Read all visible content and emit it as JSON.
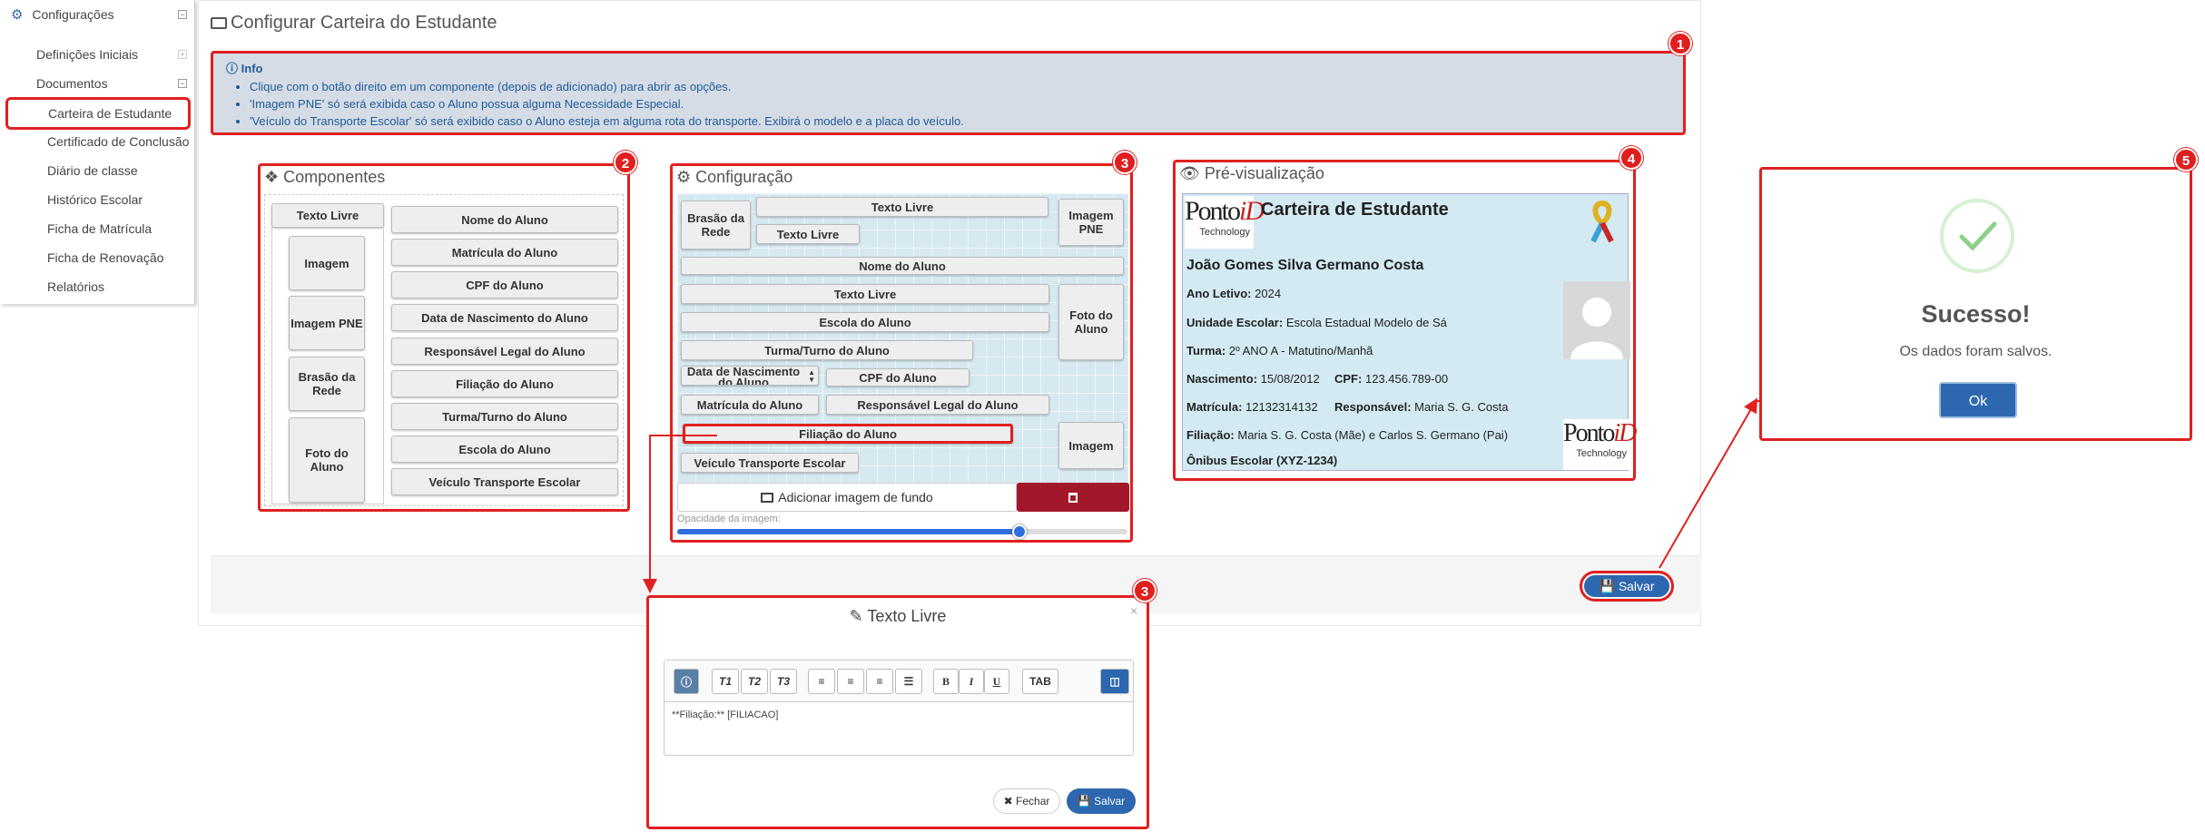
{
  "sidebar": {
    "root": "Configurações",
    "items": [
      {
        "label": "Definições Iniciais"
      },
      {
        "label": "Documentos"
      },
      {
        "label": "Carteira de Estudante"
      },
      {
        "label": "Certificado de Conclusão"
      },
      {
        "label": "Diário de classe"
      },
      {
        "label": "Histórico Escolar"
      },
      {
        "label": "Ficha de Matrícula"
      },
      {
        "label": "Ficha de Renovação"
      },
      {
        "label": "Relatórios"
      }
    ]
  },
  "page": {
    "title": "Configurar Carteira do Estudante"
  },
  "info": {
    "heading": "Info",
    "lines": [
      "Clique com o botão direito em um componente (depois de adicionado) para abrir as opções.",
      "'Imagem PNE' só será exibida caso o Aluno possua alguma Necessidade Especial.",
      "'Veículo do Transporte Escolar' só será exibido caso o Aluno esteja em alguma rota do transporte. Exibirá o modelo e a placa do veículo."
    ]
  },
  "badges": [
    "1",
    "2",
    "3",
    "4",
    "5",
    "3"
  ],
  "components": {
    "title": "Componentes",
    "left": [
      "Texto Livre",
      "Imagem",
      "Imagem PNE",
      "Brasão da Rede",
      "Foto do Aluno"
    ],
    "right": [
      "Nome do Aluno",
      "Matrícula do Aluno",
      "CPF do Aluno",
      "Data de Nascimento do Aluno",
      "Responsável Legal do Aluno",
      "Filiação do Aluno",
      "Turma/Turno do Aluno",
      "Escola do Aluno",
      "Veículo Transporte Escolar"
    ]
  },
  "config": {
    "title": "Configuração",
    "items": {
      "brasao": "Brasão da Rede",
      "texto1": "Texto Livre",
      "texto2": "Texto Livre",
      "imagem_pne": "Imagem PNE",
      "nome": "Nome do Aluno",
      "texto3": "Texto Livre",
      "escola": "Escola do Aluno",
      "foto": "Foto do Aluno",
      "turma": "Turma/Turno do Aluno",
      "nascimento": "Data de Nascimento do Aluno",
      "cpf": "CPF do Aluno",
      "matricula": "Matrícula do Aluno",
      "responsavel": "Responsável Legal do Aluno",
      "filiacao": "Filiação do Aluno",
      "imagem": "Imagem",
      "veiculo": "Veículo Transporte Escolar"
    },
    "add_bg": "Adicionar imagem de fundo",
    "opacity_label": "Opacidade da imagem:",
    "opacity": 0.76
  },
  "preview": {
    "title": "Pré-visualização",
    "logo_main": "Ponto",
    "logo_accent": "iD",
    "logo_sub": "Technology",
    "card_title": "Carteira de Estudante",
    "name": "João Gomes Silva Germano Costa",
    "ano_label": "Ano Letivo:",
    "ano": "2024",
    "unidade_label": "Unidade Escolar:",
    "unidade": "Escola Estadual Modelo de Sá",
    "turma_label": "Turma:",
    "turma": "2º ANO A - Matutino/Manhã",
    "nasc_label": "Nascimento:",
    "nasc": "15/08/2012",
    "cpf_label": "CPF:",
    "cpf": "123.456.789-00",
    "mat_label": "Matrícula:",
    "mat": "12132314132",
    "resp_label": "Responsável:",
    "resp": "Maria S. G. Costa",
    "fil_label": "Filiação:",
    "fil": "Maria S. G. Costa (Mãe) e Carlos S. Germano (Pai)",
    "onibus": "Ônibus Escolar (XYZ-1234)"
  },
  "save_button": "Salvar",
  "success": {
    "title": "Sucesso!",
    "message": "Os dados foram salvos.",
    "ok": "Ok"
  },
  "modal": {
    "title": "Texto Livre",
    "toolbar": [
      "T1",
      "T2",
      "T3",
      "B",
      "I",
      "U",
      "TAB"
    ],
    "content": "**Filiação:** [FILIACAO]",
    "close": "Fechar",
    "save": "Salvar",
    "x": "×"
  },
  "colors": {
    "accent_red": "#e02020",
    "primary_blue": "#2d67b0",
    "dark_red": "#a3172a",
    "success_green": "#8fd18a"
  }
}
